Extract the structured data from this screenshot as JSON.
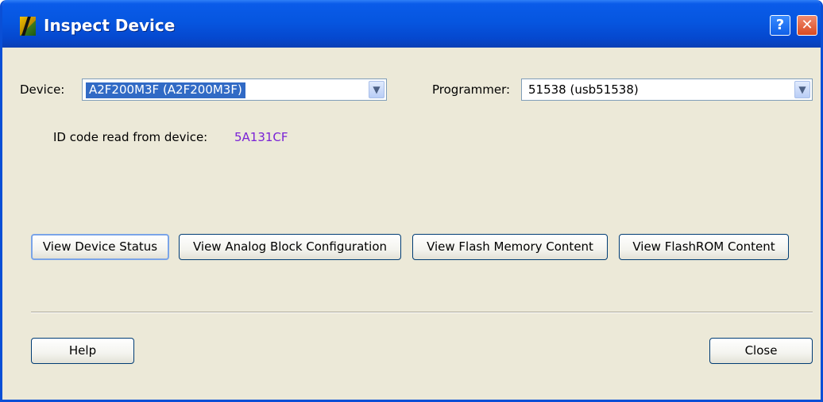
{
  "window": {
    "title": "Inspect Device",
    "help_glyph": "?",
    "close_glyph": "✕"
  },
  "device": {
    "label": "Device:",
    "value": "A2F200M3F (A2F200M3F)"
  },
  "programmer": {
    "label": "Programmer:",
    "value": "51538 (usb51538)"
  },
  "id_code": {
    "label": "ID code read from device:",
    "value": "5A131CF",
    "color": "#7a22d6"
  },
  "actions": {
    "view_device_status": "View Device Status",
    "view_analog_block": "View Analog Block Configuration",
    "view_flash_memory": "View Flash Memory Content",
    "view_flashrom": "View FlashROM Content"
  },
  "footer": {
    "help_label": "Help",
    "close_label": "Close"
  },
  "icons": {
    "app": "actel-logo-icon",
    "help": "help-icon",
    "close": "close-icon",
    "dropdown": "chevron-down-icon"
  },
  "colors": {
    "titlebar": "#0656e0",
    "selection": "#316ac5",
    "dialog_bg": "#ece9d8"
  }
}
